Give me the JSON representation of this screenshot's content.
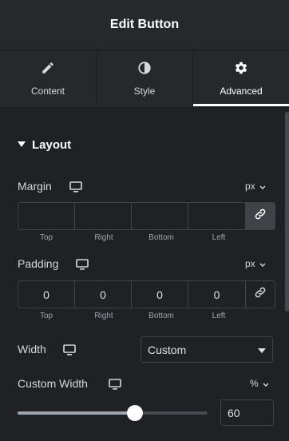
{
  "header": {
    "title": "Edit Button"
  },
  "tabs": [
    {
      "label": "Content",
      "icon": "pencil-icon"
    },
    {
      "label": "Style",
      "icon": "contrast-icon"
    },
    {
      "label": "Advanced",
      "icon": "gear-icon",
      "active": true
    }
  ],
  "section": {
    "title": "Layout"
  },
  "margin": {
    "label": "Margin",
    "unit": "px",
    "values": [
      "",
      "",
      "",
      ""
    ],
    "sublabels": [
      "Top",
      "Right",
      "Bottom",
      "Left"
    ],
    "linked": true
  },
  "padding": {
    "label": "Padding",
    "unit": "px",
    "values": [
      "0",
      "0",
      "0",
      "0"
    ],
    "sublabels": [
      "Top",
      "Right",
      "Bottom",
      "Left"
    ],
    "linked": false
  },
  "width": {
    "label": "Width",
    "value": "Custom"
  },
  "custom_width": {
    "label": "Custom Width",
    "unit": "%",
    "value": "60",
    "slider_percent": 60
  },
  "colors": {
    "panel": "#202124",
    "header": "#26292c",
    "accent": "#ffffff"
  }
}
